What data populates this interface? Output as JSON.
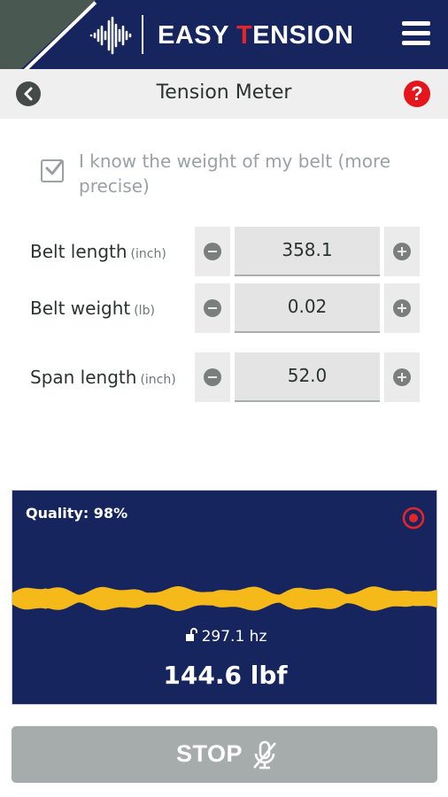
{
  "header": {
    "brand_prefix": "EASY ",
    "brand_accent": "T",
    "brand_suffix": "ENSION",
    "menu_icon": "hamburger-menu-icon"
  },
  "titlebar": {
    "title": "Tension Meter",
    "back_icon": "chevron-left-icon",
    "help_icon": "question-mark-icon",
    "help_symbol": "?"
  },
  "weight_option": {
    "checked": true,
    "label": "I know the weight of my belt (more precise)"
  },
  "inputs": [
    {
      "label": "Belt length",
      "unit": "(inch)",
      "value": "358.1"
    },
    {
      "label": "Belt weight",
      "unit": "(lb)",
      "value": "0.02"
    },
    {
      "label": "Span length",
      "unit": "(inch)",
      "value": "52.0"
    }
  ],
  "measurement": {
    "quality": "Quality: 98%",
    "frequency": "297.1 hz",
    "tension": "144.6 lbf",
    "record_icon": "target-record-icon",
    "lock_icon": "unlock-icon"
  },
  "stop_button": {
    "label": "STOP",
    "icon": "microphone-off-icon"
  },
  "colors": {
    "navy": "#17255e",
    "accent_red": "#e4262a",
    "wave_yellow": "#f6b91a",
    "stop_gray": "#a6abac"
  }
}
